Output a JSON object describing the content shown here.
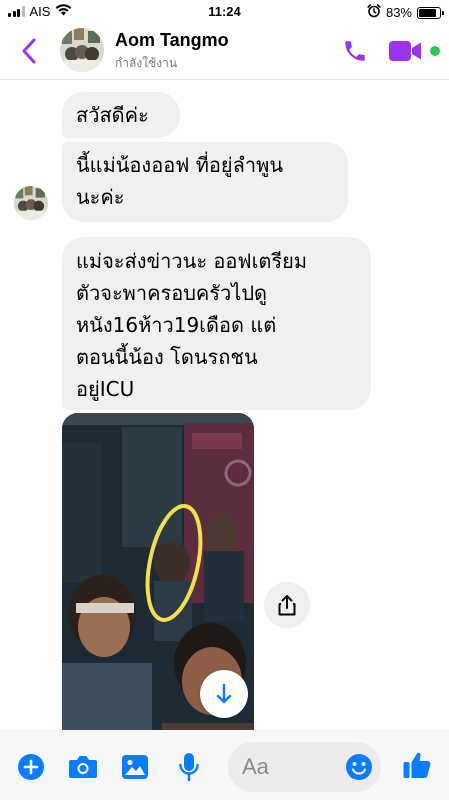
{
  "status_bar": {
    "carrier": "AIS",
    "time": "11:24",
    "battery": "83%",
    "battery_level": 0.83
  },
  "header": {
    "contact_name": "Aom Tangmo",
    "contact_status": "กำลังใช้งาน",
    "online": true
  },
  "messages": [
    {
      "lines": [
        "สวัสดีค่ะ"
      ]
    },
    {
      "lines": [
        "นี้แม่น้องออฟ ที่อยู่ลำพูน",
        "นะค่ะ"
      ]
    },
    {
      "lines": [
        "แม่จะส่งข่าวนะ ออฟเตรียม",
        "ตัวจะพาครอบครัวไปดู",
        "หนัง16ห้าว19เดือด แต่",
        "ตอนนี้น้อง โดนรถชน",
        "อยู่ICU"
      ]
    }
  ],
  "composer": {
    "placeholder": "Aa"
  },
  "colors": {
    "messenger_purple": "#9b33f0",
    "online_green": "#31c55a",
    "bubble_gray": "#f0f0f0",
    "action_blue": "#0a7cff"
  },
  "icons": [
    "back-arrow-icon",
    "phone-icon",
    "video-camera-icon",
    "plus-icon",
    "camera-icon",
    "image-icon",
    "microphone-icon",
    "emoji-icon",
    "thumbs-up-icon",
    "share-icon",
    "download-icon"
  ]
}
